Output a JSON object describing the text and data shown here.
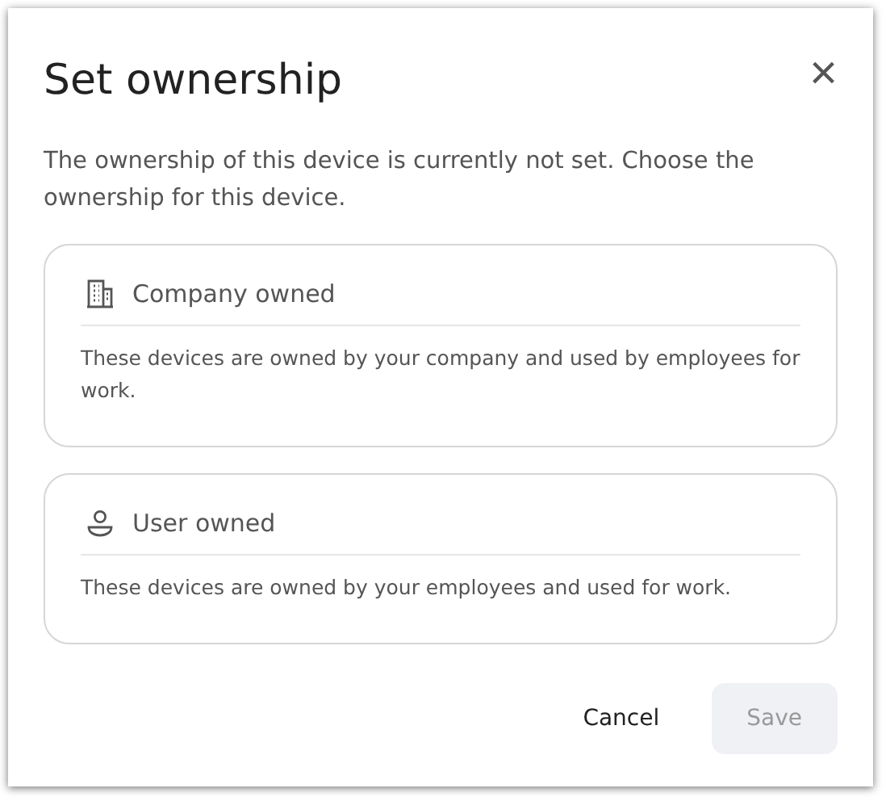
{
  "dialog": {
    "title": "Set ownership",
    "close_icon": "×",
    "description": "The ownership of this device is currently not set. Choose the ownership for this device.",
    "options": [
      {
        "kind": "company",
        "label": "Company owned",
        "description": "These devices are owned by your company and used by employees for work.",
        "selected": false
      },
      {
        "kind": "user",
        "label": "User owned",
        "description": "These devices are owned by your employees and used for work.",
        "selected": false
      }
    ],
    "buttons": [
      {
        "label": "Cancel",
        "kind": "text",
        "disabled": false
      },
      {
        "label": "Save",
        "kind": "filled",
        "disabled": true
      }
    ]
  }
}
